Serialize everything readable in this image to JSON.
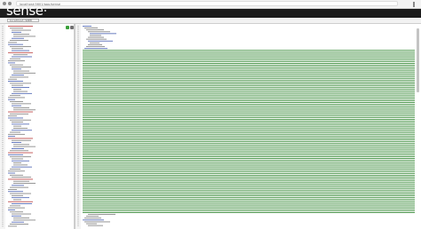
{
  "browser": {
    "address": "localhost:5601/app/sense"
  },
  "app": {
    "logo": "sense"
  },
  "server": {
    "value": "localhost:9200"
  },
  "colors": {
    "header_bg": "#1c1c1c",
    "code_grey": "#8a8a8a",
    "code_green": "#3a8c3a",
    "code_blue": "#5a6fb8",
    "code_red": "#c05050",
    "gutter": "#f4f4f4"
  },
  "icons": {
    "run": "play-icon",
    "settings": "wrench-icon"
  }
}
